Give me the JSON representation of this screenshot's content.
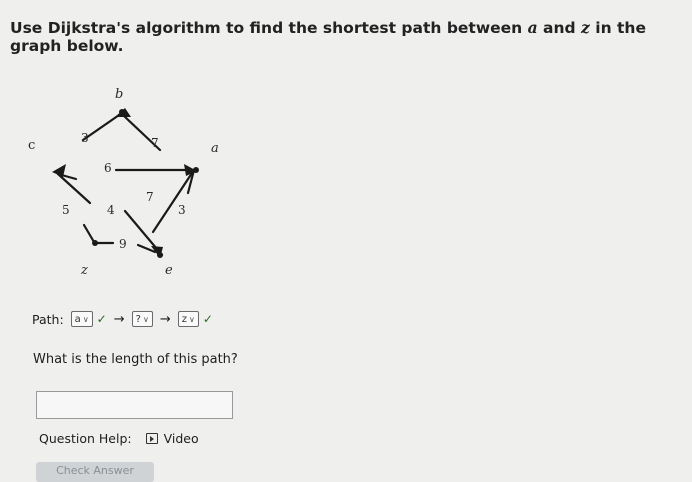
{
  "question": {
    "prefix": "Use Dijkstra's algorithm to find the shortest path between ",
    "var_a": "a",
    "and": " and ",
    "var_z": "z",
    "suffix": " in the graph below."
  },
  "graph": {
    "nodes": {
      "b": "b",
      "c": "c",
      "a": "a",
      "z": "z",
      "e": "e"
    },
    "weights": {
      "b_c": "3",
      "b_a": "7",
      "a_c": "6",
      "a_e": "7",
      "c_z": "5",
      "c_e": "4",
      "a_e_right": "3",
      "z_e": "9"
    }
  },
  "path": {
    "label": "Path:",
    "selects": [
      "a",
      "?",
      "z"
    ],
    "arrow": "→"
  },
  "length_question": "What is the length of this path?",
  "answer_value": "",
  "help": {
    "label": "Question Help:",
    "video": "Video"
  },
  "check_answer": "Check Answer"
}
